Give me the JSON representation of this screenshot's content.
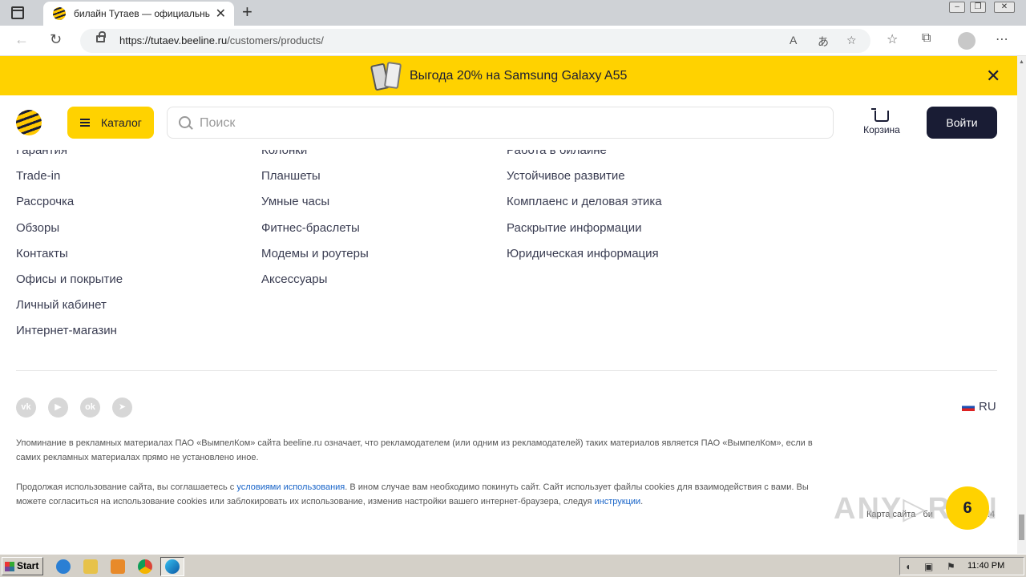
{
  "browser": {
    "tab_title": "билайн Тутаев — официальный сайт",
    "url_host": "https://tutaev.beeline.ru",
    "url_path": "/customers/products/"
  },
  "promo": {
    "text": "Выгода 20% на Samsung Galaxy A55"
  },
  "header": {
    "catalog_label": "Каталог",
    "search_placeholder": "Поиск",
    "cart_label": "Корзина",
    "login_label": "Войти"
  },
  "footer": {
    "col1": [
      "Гарантия",
      "Trade-in",
      "Рассрочка",
      "Обзоры",
      "Контакты",
      "Офисы и покрытие",
      "Личный кабинет",
      "Интернет-магазин"
    ],
    "col2": [
      "Колонки",
      "Планшеты",
      "Умные часы",
      "Фитнес-браслеты",
      "Модемы и роутеры",
      "Аксессуары"
    ],
    "col3": [
      "Работа в билайне",
      "Устойчивое развитие",
      "Комплаенс и деловая этика",
      "Раскрытие информации",
      "Юридическая информация"
    ],
    "social": [
      "vk",
      "youtube",
      "ok",
      "telegram"
    ],
    "lang": "RU",
    "legal1": "Упоминание в рекламных материалах ПАО «ВымпелКом» сайта beeline.ru означает, что рекламодателем (или одним из рекламодателей) таких материалов является ПАО «ВымпелКом», если в самих рекламных материалах прямо не установлено иное.",
    "legal2_before": "Продолжая использование сайта, вы соглашаетесь с ",
    "legal2_link": "условиями использования",
    "legal2_after": ". В ином случае вам необходимо покинуть сайт. Сайт использует файлы cookies для взаимодействия с вами. Вы можете согласиться на использование cookies или заблокировать их использование, изменив настройки вашего интернет-браузера, следуя ",
    "legal2_link2": "инструкции",
    "legal2_end": ".",
    "sitemap": "Карта сайта",
    "sitemap_tail": "би",
    "sitemap_year": ".4"
  },
  "taskbar": {
    "start": "Start",
    "clock": "11:40 PM"
  },
  "colors": {
    "brand_yellow": "#ffd200",
    "brand_dark": "#191c34",
    "link_blue": "#1864c8"
  }
}
